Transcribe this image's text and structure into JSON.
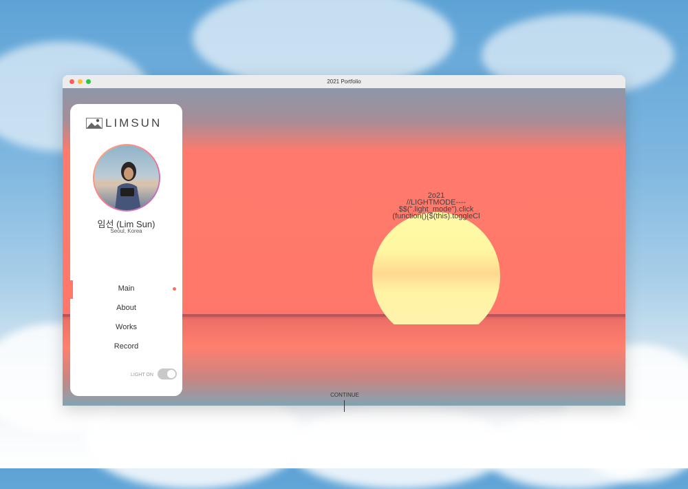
{
  "window": {
    "title": "2021 Portfolio"
  },
  "sidebar": {
    "logo_text": "LIMSUN",
    "profile": {
      "name": "임선 (Lim Sun)",
      "location": "Seoul, Korea"
    },
    "nav": [
      {
        "label": "Main",
        "active": true
      },
      {
        "label": "About",
        "active": false
      },
      {
        "label": "Works",
        "active": false
      },
      {
        "label": "Record",
        "active": false
      }
    ],
    "toggle": {
      "label": "LIGHT ON",
      "state": "on"
    }
  },
  "hero": {
    "code_lines": [
      "2o21",
      "//LIGHTMODE----",
      "$$(\".light_mode\").click",
      "(function(){$(this).toggleCl"
    ],
    "continue_label": "CONTINUE"
  },
  "colors": {
    "accent": "#ff7a6b",
    "sun": "#fff7a2",
    "sky": "#8e97a8"
  },
  "icons": [
    "window-close-icon",
    "window-minimize-icon",
    "window-maximize-icon",
    "logo-landscape-icon"
  ]
}
